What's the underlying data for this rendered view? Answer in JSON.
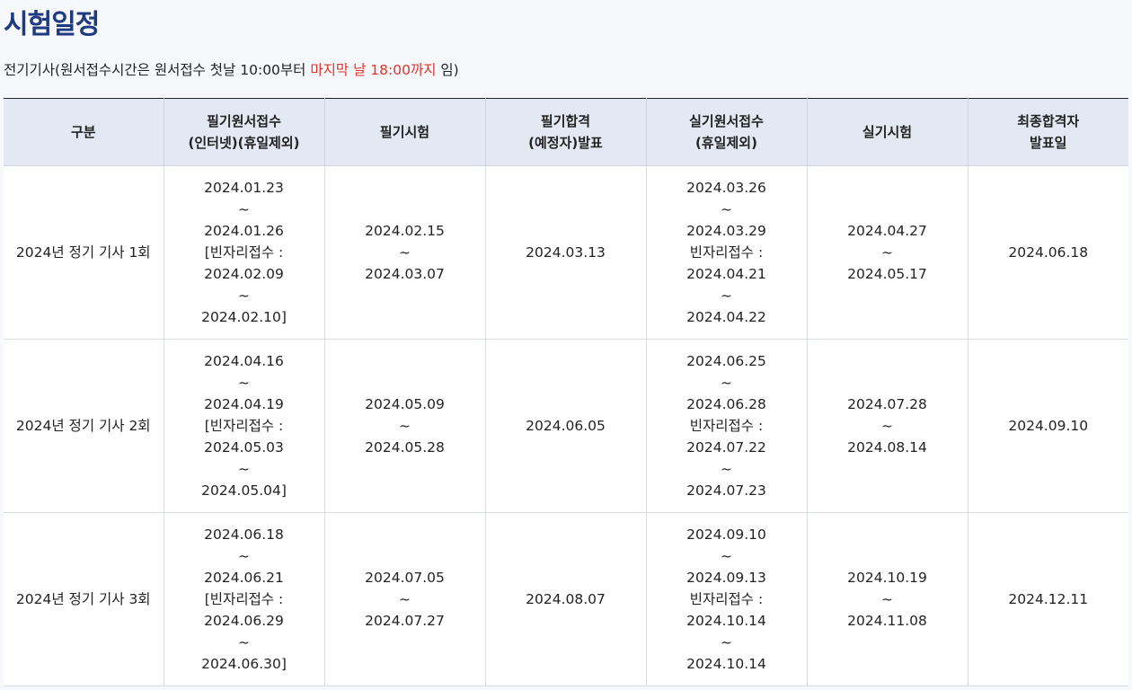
{
  "page_title": "시험일정",
  "notice": {
    "prefix": "전기기사(원서접수시간은 원서접수 첫날 10:00부터 ",
    "highlight": "마지막 날 18:00까지",
    "suffix": " 임)",
    "highlight_color": "#e0342b"
  },
  "table": {
    "headers": [
      [
        "구분"
      ],
      [
        "필기원서접수",
        "(인터넷)(휴일제외)"
      ],
      [
        "필기시험"
      ],
      [
        "필기합격",
        "(예정자)발표"
      ],
      [
        "실기원서접수",
        "(휴일제외)"
      ],
      [
        "실기시험"
      ],
      [
        "최종합격자",
        "발표일"
      ]
    ],
    "rows": [
      {
        "round": "2024년 정기 기사 1회",
        "written_apply": [
          "2024.01.23",
          "~",
          "2024.01.26",
          "[빈자리접수 :",
          "2024.02.09",
          "~",
          "2024.02.10]"
        ],
        "written_exam": [
          "2024.02.15",
          "~",
          "2024.03.07"
        ],
        "written_result": [
          "2024.03.13"
        ],
        "practical_apply": [
          "2024.03.26",
          "~",
          "2024.03.29",
          "빈자리접수 :",
          "2024.04.21",
          "~",
          "2024.04.22"
        ],
        "practical_exam": [
          "2024.04.27",
          "~",
          "2024.05.17"
        ],
        "final_result": [
          "2024.06.18"
        ]
      },
      {
        "round": "2024년 정기 기사 2회",
        "written_apply": [
          "2024.04.16",
          "~",
          "2024.04.19",
          "[빈자리접수 :",
          "2024.05.03",
          "~",
          "2024.05.04]"
        ],
        "written_exam": [
          "2024.05.09",
          "~",
          "2024.05.28"
        ],
        "written_result": [
          "2024.06.05"
        ],
        "practical_apply": [
          "2024.06.25",
          "~",
          "2024.06.28",
          "빈자리접수 :",
          "2024.07.22",
          "~",
          "2024.07.23"
        ],
        "practical_exam": [
          "2024.07.28",
          "~",
          "2024.08.14"
        ],
        "final_result": [
          "2024.09.10"
        ]
      },
      {
        "round": "2024년 정기 기사 3회",
        "written_apply": [
          "2024.06.18",
          "~",
          "2024.06.21",
          "[빈자리접수 :",
          "2024.06.29",
          "~",
          "2024.06.30]"
        ],
        "written_exam": [
          "2024.07.05",
          "~",
          "2024.07.27"
        ],
        "written_result": [
          "2024.08.07"
        ],
        "practical_apply": [
          "2024.09.10",
          "~",
          "2024.09.13",
          "빈자리접수 :",
          "2024.10.14",
          "~",
          "2024.10.14"
        ],
        "practical_exam": [
          "2024.10.19",
          "~",
          "2024.11.08"
        ],
        "final_result": [
          "2024.12.11"
        ]
      }
    ]
  }
}
